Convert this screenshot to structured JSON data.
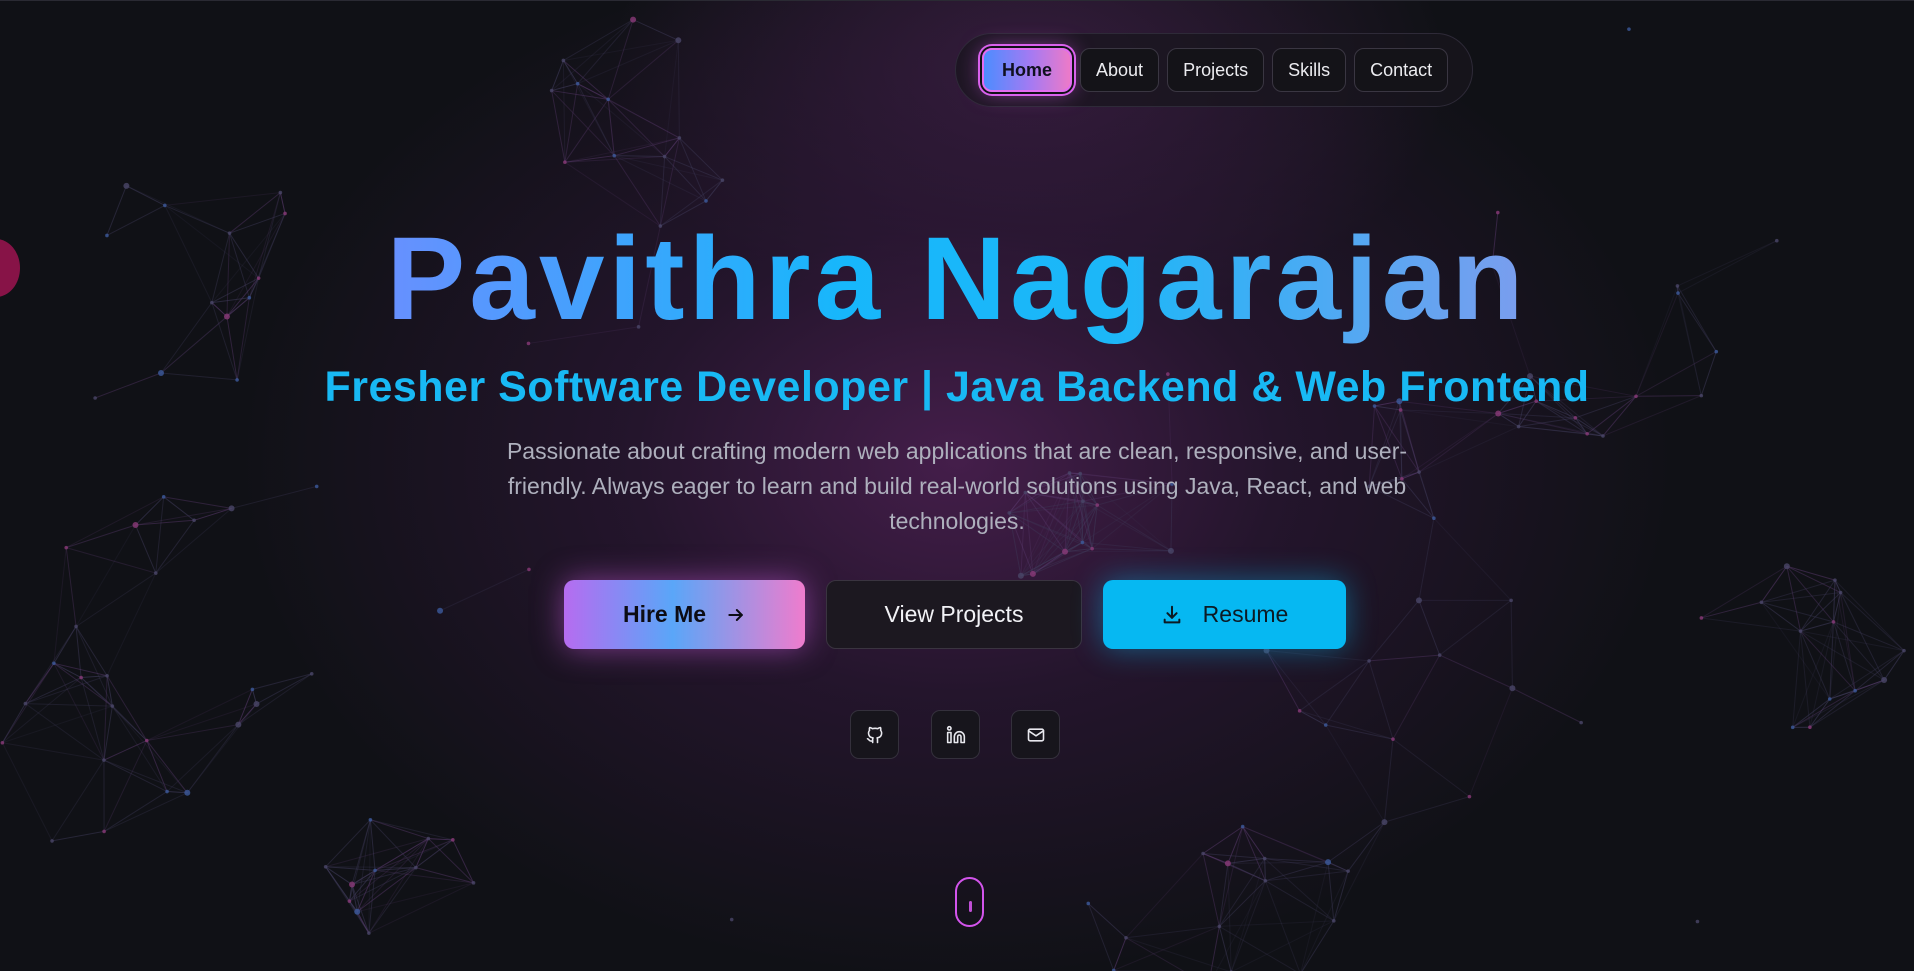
{
  "nav": {
    "items": [
      {
        "label": "Home",
        "active": true
      },
      {
        "label": "About",
        "active": false
      },
      {
        "label": "Projects",
        "active": false
      },
      {
        "label": "Skills",
        "active": false
      },
      {
        "label": "Contact",
        "active": false
      }
    ]
  },
  "hero": {
    "name": "Pavithra Nagarajan",
    "subtitle": "Fresher Software Developer | Java Backend & Web Frontend",
    "description": "Passionate about crafting modern web applications that are clean, responsive, and user-friendly. Always eager to learn and build real-world solutions using Java, React, and web technologies."
  },
  "buttons": {
    "hire": {
      "label": "Hire Me",
      "icon": "arrow-right-icon"
    },
    "projects": {
      "label": "View Projects"
    },
    "resume": {
      "label": "Resume",
      "icon": "download-icon"
    }
  },
  "social": [
    {
      "icon": "github-icon"
    },
    {
      "icon": "linkedin-icon"
    },
    {
      "icon": "mail-icon"
    }
  ],
  "colors": {
    "background": "#101116",
    "accent_cyan": "#18b9f4",
    "accent_pink": "#d354ec",
    "accent_purple": "#b46cf2"
  }
}
